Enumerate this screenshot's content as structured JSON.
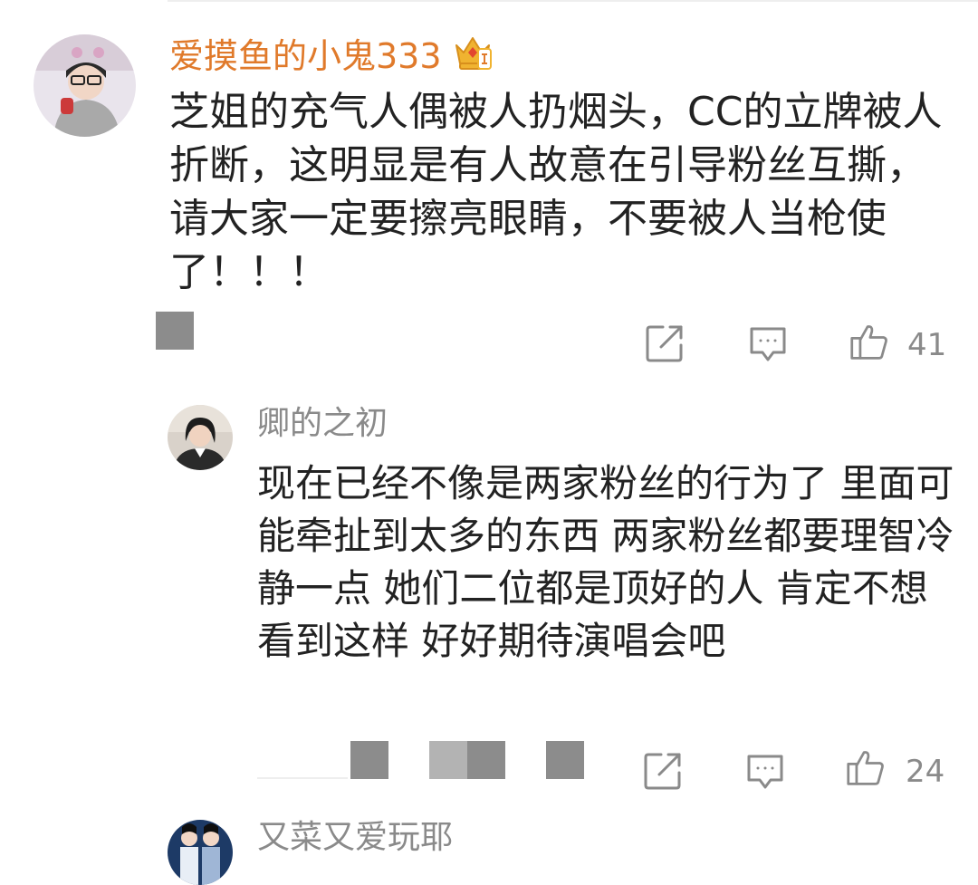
{
  "comment": {
    "username": "爱摸鱼的小鬼333",
    "text": "芝姐的充气人偶被人扔烟头，CC的立牌被人折断，这明显是有人故意在引导粉丝互撕，请大家一定要擦亮眼睛，不要被人当枪使了！！！",
    "likes": "41",
    "badge_icon": "crown-icon",
    "share_icon": "share-icon",
    "reply_icon": "comment-icon",
    "like_icon": "thumbs-up-icon"
  },
  "reply": {
    "username": "卿的之初",
    "text": "现在已经不像是两家粉丝的行为了 里面可能牵扯到太多的东西 两家粉丝都要理智冷静一点 她们二位都是顶好的人 肯定不想看到这样 好好期待演唱会吧",
    "likes": "24"
  },
  "next_reply": {
    "username": "又菜又爱玩耶"
  },
  "colors": {
    "username_main": "#e07a2b",
    "username_secondary": "#8a8a8a",
    "text": "#222222",
    "icon": "#8a8a8a",
    "crown_gold": "#f0b330",
    "crown_red": "#e2462f"
  }
}
